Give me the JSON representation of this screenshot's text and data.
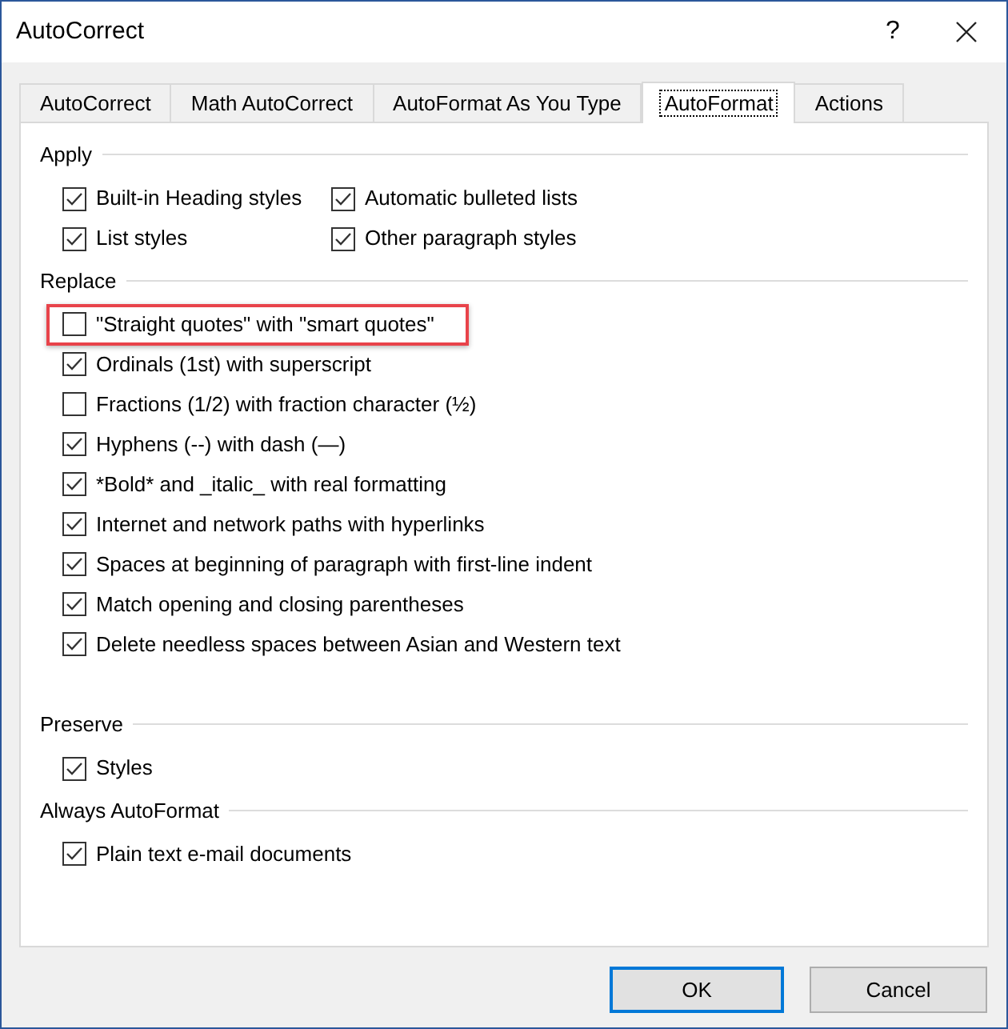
{
  "window": {
    "title": "AutoCorrect",
    "help": "?"
  },
  "tabs": [
    {
      "label": "AutoCorrect",
      "selected": false
    },
    {
      "label": "Math AutoCorrect",
      "selected": false
    },
    {
      "label": "AutoFormat As You Type",
      "selected": false
    },
    {
      "label": "AutoFormat",
      "selected": true
    },
    {
      "label": "Actions",
      "selected": false
    }
  ],
  "groups": [
    {
      "title": "Apply",
      "kind": "grid",
      "options": [
        {
          "label": "Built-in Heading styles",
          "checked": true
        },
        {
          "label": "Automatic bulleted lists",
          "checked": true
        },
        {
          "label": "List styles",
          "checked": true
        },
        {
          "label": "Other paragraph styles",
          "checked": true
        }
      ]
    },
    {
      "title": "Replace",
      "kind": "list",
      "options": [
        {
          "label": "\"Straight quotes\" with \"smart quotes\"",
          "checked": false,
          "highlighted": true
        },
        {
          "label": "Ordinals (1st) with superscript",
          "checked": true,
          "highlighted": false
        },
        {
          "label": "Fractions (1/2) with fraction character (½)",
          "checked": false,
          "highlighted": false
        },
        {
          "label": "Hyphens (--) with dash (—)",
          "checked": true,
          "highlighted": false
        },
        {
          "label": "*Bold* and _italic_ with real formatting",
          "checked": true,
          "highlighted": false
        },
        {
          "label": "Internet and network paths with hyperlinks",
          "checked": true,
          "highlighted": false
        },
        {
          "label": "Spaces at beginning of paragraph with first-line indent",
          "checked": true,
          "highlighted": false
        },
        {
          "label": "Match opening and closing parentheses",
          "checked": true,
          "highlighted": false
        },
        {
          "label": "Delete needless spaces between Asian and Western text",
          "checked": true,
          "highlighted": false
        }
      ]
    },
    {
      "title": "Preserve",
      "kind": "list",
      "options": [
        {
          "label": "Styles",
          "checked": true
        }
      ]
    },
    {
      "title": "Always AutoFormat",
      "kind": "list",
      "options": [
        {
          "label": "Plain text e-mail documents",
          "checked": true
        }
      ]
    }
  ],
  "buttons": [
    {
      "label": "OK",
      "default": true
    },
    {
      "label": "Cancel",
      "default": false
    }
  ]
}
